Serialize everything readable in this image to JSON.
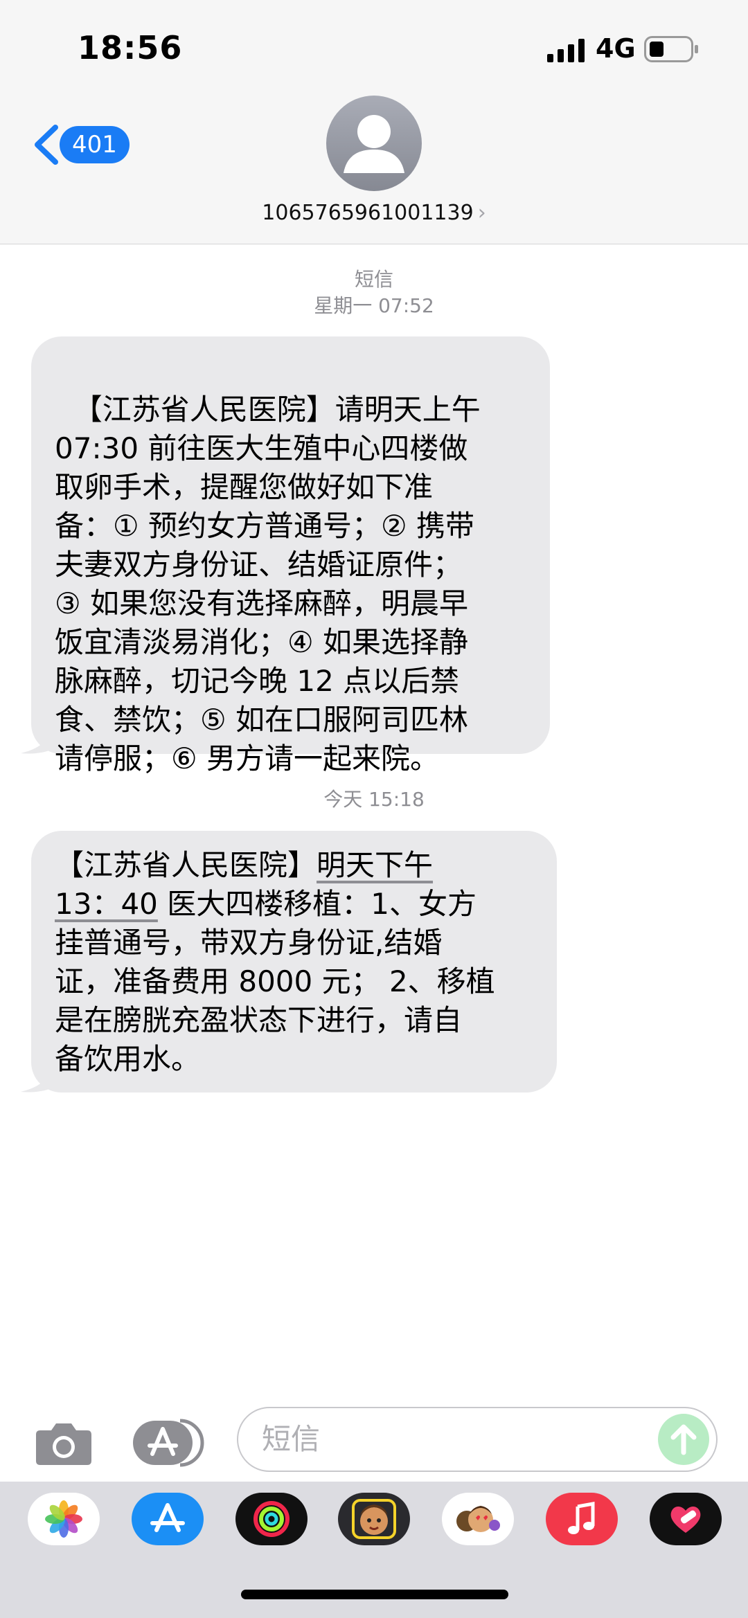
{
  "status_bar": {
    "time": "18:56",
    "network": "4G"
  },
  "header": {
    "back_badge": "401",
    "contact": "1065765961001139",
    "chevron": "›"
  },
  "thread": {
    "service_label": "短信",
    "first_timestamp": "星期一 07:52",
    "messages": [
      {
        "text": "【江苏省人民医院】请明天上午\n07:30 前往医大生殖中心四楼做\n取卵手术，提醒您做好如下准\n备：① 预约女方普通号；② 携带\n夫妻双方身份证、结婚证原件；\n③ 如果您没有选择麻醉，明晨早\n饭宜清淡易消化；④ 如果选择静\n脉麻醉，切记今晚 12 点以后禁\n食、禁饮；⑤ 如在口服阿司匹林\n请停服；⑥ 男方请一起来院。"
      },
      {
        "text_before": "【江苏省人民医院】",
        "text_underlined_1": "明天下午",
        "newline": "\n",
        "text_underlined_2": "13：40",
        "text_after": " 医大四楼移植：1、女方\n挂普通号，带双方身份证,结婚\n证，准备费用 8000 元； 2、移植\n是在膀胱充盈状态下进行，请自\n备饮用水。"
      }
    ],
    "second_timestamp": "今天 15:18"
  },
  "composer": {
    "placeholder": "短信"
  },
  "dock": {
    "icons": [
      "photos-icon",
      "app-store-icon",
      "activity-icon",
      "memoji-icon",
      "memoji-stickers-icon",
      "music-icon",
      "heart-app-icon"
    ]
  },
  "colors": {
    "accent": "#1a7cf5",
    "bubble": "#e9e9eb",
    "send": "#b8ecc4"
  }
}
